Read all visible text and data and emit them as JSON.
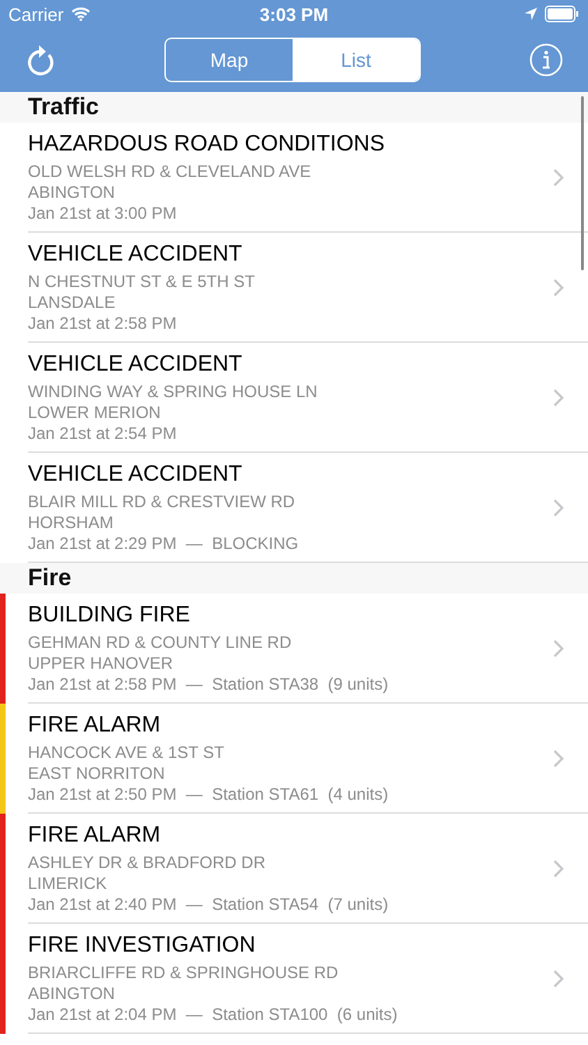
{
  "status_bar": {
    "carrier": "Carrier",
    "time": "3:03 PM"
  },
  "nav": {
    "segments": [
      {
        "label": "Map",
        "selected": false
      },
      {
        "label": "List",
        "selected": true
      }
    ]
  },
  "sections": [
    {
      "title": "Traffic",
      "items": [
        {
          "title": "HAZARDOUS ROAD CONDITIONS",
          "address": "OLD WELSH RD & CLEVELAND AVE",
          "area": "ABINGTON",
          "detail": "Jan 21st at 3:00 PM"
        },
        {
          "title": "VEHICLE ACCIDENT",
          "address": "N CHESTNUT ST & E 5TH ST",
          "area": "LANSDALE",
          "detail": "Jan 21st at 2:58 PM"
        },
        {
          "title": "VEHICLE ACCIDENT",
          "address": "WINDING WAY & SPRING HOUSE LN",
          "area": "LOWER MERION",
          "detail": "Jan 21st at 2:54 PM"
        },
        {
          "title": "VEHICLE ACCIDENT",
          "address": "BLAIR MILL RD & CRESTVIEW RD",
          "area": "HORSHAM",
          "detail": "Jan 21st at 2:29 PM  —  BLOCKING"
        }
      ]
    },
    {
      "title": "Fire",
      "items": [
        {
          "title": "BUILDING FIRE",
          "address": "GEHMAN RD & COUNTY LINE RD",
          "area": "UPPER HANOVER",
          "detail": "Jan 21st at 2:58 PM  —  Station STA38  (9 units)",
          "color": "#e0231d"
        },
        {
          "title": "FIRE ALARM",
          "address": "HANCOCK AVE & 1ST ST",
          "area": "EAST NORRITON",
          "detail": "Jan 21st at 2:50 PM  —  Station STA61  (4 units)",
          "color": "#f5c518"
        },
        {
          "title": "FIRE ALARM",
          "address": "ASHLEY DR & BRADFORD DR",
          "area": "LIMERICK",
          "detail": "Jan 21st at 2:40 PM  —  Station STA54  (7 units)",
          "color": "#e0231d"
        },
        {
          "title": "FIRE INVESTIGATION",
          "address": "BRIARCLIFFE RD & SPRINGHOUSE RD",
          "area": "ABINGTON",
          "detail": "Jan 21st at 2:04 PM  —  Station STA100  (6 units)",
          "color": "#e0231d"
        }
      ]
    }
  ]
}
